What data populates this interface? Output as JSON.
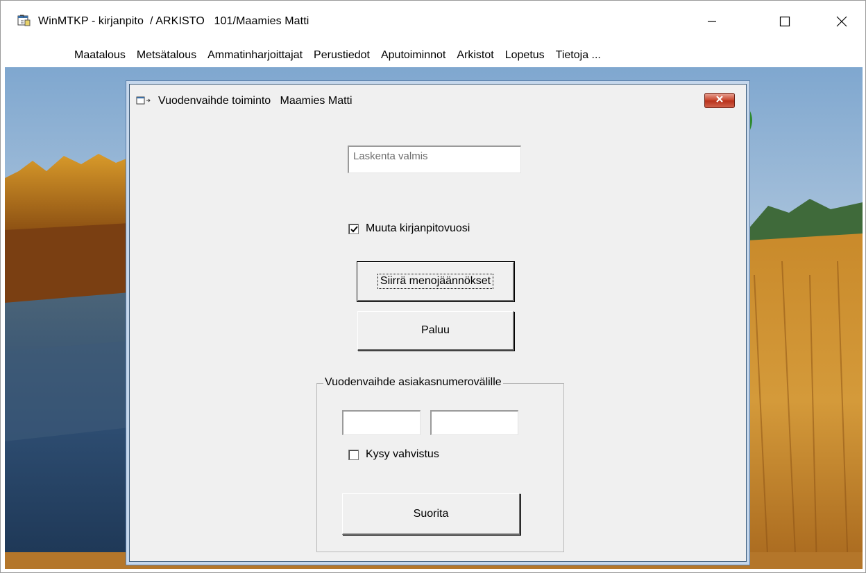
{
  "window": {
    "title": "WinMTKP - kirjanpito  / ARKISTO   101/Maamies Matti",
    "icon": "app-window-icon",
    "controls": [
      "minimize-icon",
      "maximize-icon",
      "close-icon"
    ]
  },
  "menu": {
    "items": [
      {
        "label": "Maatalous"
      },
      {
        "label": "Metsätalous"
      },
      {
        "label": "Ammatinharjoittajat"
      },
      {
        "label": "Perustiedot"
      },
      {
        "label": "Aputoiminnot"
      },
      {
        "label": "Arkistot"
      },
      {
        "label": "Lopetus"
      },
      {
        "label": "Tietoja ..."
      }
    ]
  },
  "dialog": {
    "title": "Vuodenvaihde toiminto   Maamies Matti",
    "status_text": "Laskenta valmis",
    "change_year": {
      "label": "Muuta kirjanpitovuosi",
      "checked": true
    },
    "transfer_button": "Siirrä menojäännökset",
    "return_button": "Paluu",
    "group": {
      "legend": "Vuodenvaihde asiakasnumerovälille",
      "range_start": "",
      "range_end": "",
      "confirm": {
        "label": "Kysy vahvistus",
        "checked": false
      },
      "run_button": "Suorita"
    }
  },
  "colors": {
    "dialog_bg": "#f0f0f0",
    "close_button": "#c8452c",
    "window_bg": "#ffffff"
  }
}
